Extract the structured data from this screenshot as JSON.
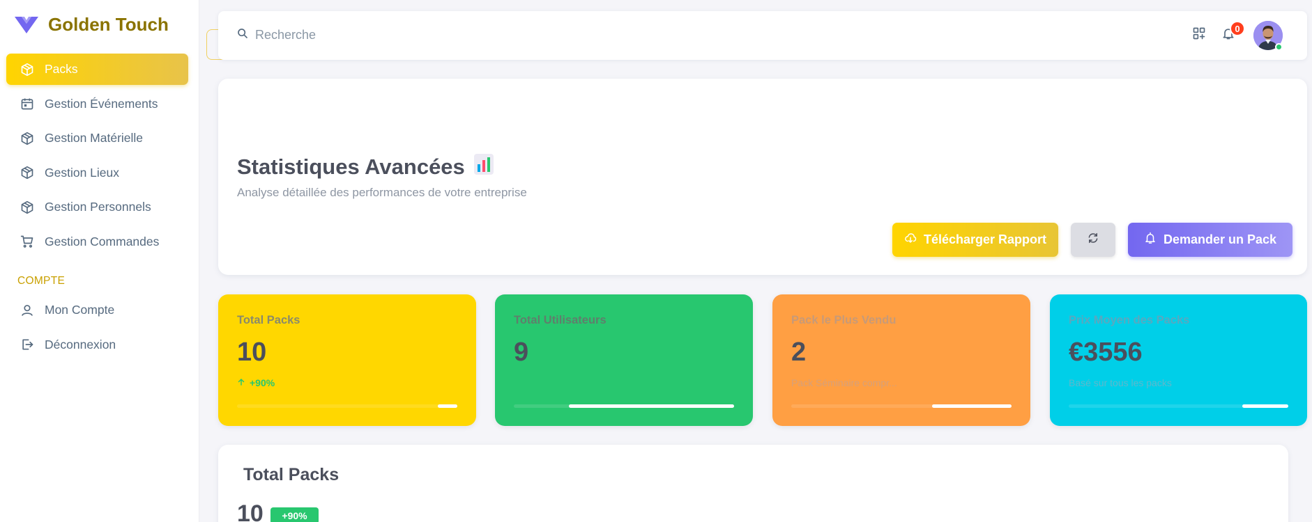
{
  "brand": {
    "name": "Golden Touch"
  },
  "sidebar": {
    "items": [
      {
        "label": "Packs",
        "icon": "cube-icon",
        "active": true
      },
      {
        "label": "Gestion Événements",
        "icon": "calendar-icon"
      },
      {
        "label": "Gestion Matérielle",
        "icon": "cube-icon"
      },
      {
        "label": "Gestion Lieux",
        "icon": "cube-icon"
      },
      {
        "label": "Gestion Personnels",
        "icon": "cube-icon"
      },
      {
        "label": "Gestion Commandes",
        "icon": "cart-icon"
      }
    ],
    "section_title": "COMPTE",
    "account_items": [
      {
        "label": "Mon Compte",
        "icon": "user-icon"
      },
      {
        "label": "Déconnexion",
        "icon": "logout-icon"
      }
    ]
  },
  "topbar": {
    "search_placeholder": "Recherche",
    "notification_count": "0"
  },
  "header": {
    "title": "Statistiques Avancées",
    "subtitle": "Analyse détaillée des performances de votre entreprise",
    "download_label": "Télécharger Rapport",
    "request_label": "Demander un Pack"
  },
  "stats": [
    {
      "label": "Total Packs",
      "value": "10",
      "sub": "+90%",
      "color": "#ffd700",
      "progress": 0.09
    },
    {
      "label": "Total Utilisateurs",
      "value": "9",
      "sub": "",
      "color": "#28c76f",
      "progress": 0.75
    },
    {
      "label": "Pack le Plus Vendu",
      "value": "2",
      "sub": "Pack Séminaire compr...",
      "color": "#ff9f43",
      "progress": 0.36
    },
    {
      "label": "Prix Moyen des Packs",
      "value": "€3556",
      "sub": "Basé sur tous les packs",
      "color": "#00cfe8",
      "progress": 0.21
    }
  ],
  "bottom": {
    "title": "Total Packs",
    "value": "10",
    "badge": "+90%"
  },
  "colors": {
    "accent_yellow": "#ffd400",
    "accent_purple": "#7367f0",
    "brand_text": "#8a7300",
    "badge_red": "#ff3e1d"
  }
}
